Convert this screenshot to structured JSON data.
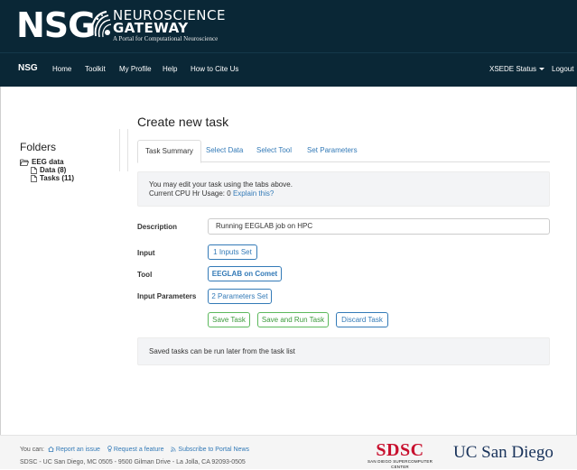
{
  "logo": {
    "nsg": "NSG",
    "line1": "NEUROSCIENCE",
    "line2": "GATEWAY",
    "line3": "A Portal for Computational Neuroscience"
  },
  "nav": {
    "brand": "NSG",
    "items": [
      "Home",
      "Toolkit",
      "My Profile",
      "Help",
      "How to Cite Us"
    ],
    "xsede": "XSEDE Status",
    "logout": "Logout"
  },
  "sidebar": {
    "title": "Folders",
    "folder": "EEG data",
    "children": [
      "Data (8)",
      "Tasks (11)"
    ]
  },
  "main": {
    "title": "Create new task",
    "tabs": [
      "Task Summary",
      "Select Data",
      "Select Tool",
      "Set Parameters"
    ],
    "info_line1": "You may edit your task using the tabs above.",
    "info_line2_prefix": "Current CPU Hr Usage: 0",
    "info_link": "Explain this?",
    "description_label": "Description",
    "description_value": "Running EEGLAB job on HPC",
    "input_label": "Input",
    "input_button": "1 Inputs Set",
    "tool_label": "Tool",
    "tool_button": "EEGLAB on Comet",
    "params_label": "Input Parameters",
    "params_button": "2 Parameters Set",
    "save_task": "Save Task",
    "save_run": "Save and Run Task",
    "discard": "Discard Task",
    "saved_note": "Saved tasks can be run later from the task list"
  },
  "footer": {
    "you_can": "You can:",
    "links": [
      "Report an issue",
      "Request a feature",
      "Subscribe to Portal News"
    ],
    "address": "SDSC - UC San Diego, MC 0505 - 9500 Gilman Drive - La Jolla, CA 92093-0505",
    "sdsc": "SDSC",
    "sdsc_sub": "SAN DIEGO SUPERCOMPUTER CENTER",
    "ucsd": "UC San Diego"
  },
  "colors": {
    "header_bg": "#0a2736",
    "link": "#337ab7",
    "success": "#5cb85c",
    "sdsc_red": "#c8102e",
    "ucsd_navy": "#18325a"
  },
  "icons": [
    "logo-swirl-icon",
    "folder-open-icon",
    "file-icon",
    "home-icon",
    "lightbulb-icon",
    "rss-icon",
    "caret-down-icon"
  ]
}
